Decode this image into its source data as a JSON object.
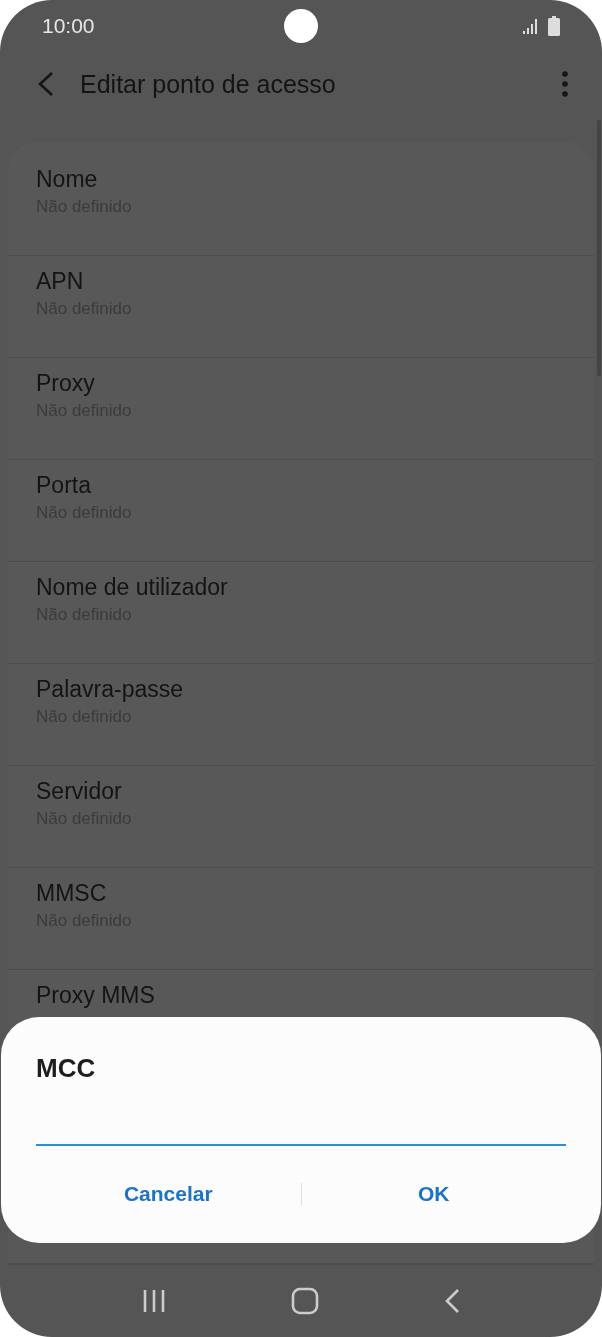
{
  "status_bar": {
    "time": "10:00"
  },
  "app_bar": {
    "title": "Editar ponto de acesso"
  },
  "settings": [
    {
      "title": "Nome",
      "value": "Não definido"
    },
    {
      "title": "APN",
      "value": "Não definido"
    },
    {
      "title": "Proxy",
      "value": "Não definido"
    },
    {
      "title": "Porta",
      "value": "Não definido"
    },
    {
      "title": "Nome de utilizador",
      "value": "Não definido"
    },
    {
      "title": "Palavra-passe",
      "value": "Não definido"
    },
    {
      "title": "Servidor",
      "value": "Não definido"
    },
    {
      "title": "MMSC",
      "value": "Não definido"
    },
    {
      "title": "Proxy MMS"
    }
  ],
  "dialog": {
    "title": "MCC",
    "buttons": [
      "Cancelar",
      "OK"
    ]
  }
}
